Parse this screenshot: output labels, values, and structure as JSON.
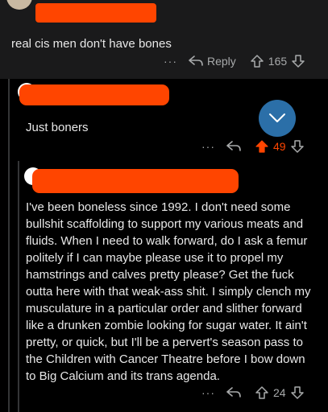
{
  "comments": [
    {
      "text": "real cis men don't have bones",
      "reply_label": "Reply",
      "score": "165",
      "more": "···"
    },
    {
      "text": "Just boners",
      "score": "49",
      "more": "···",
      "vote_color": "#ff4500"
    },
    {
      "text": "I've been boneless since 1992. I don't need some bullshit scaffolding to support my various meats and fluids. When I need to walk forward, do I ask a femur politely if I can maybe please use it to propel my hamstrings and calves pretty please? Get the fuck outta here with that weak-ass shit. I simply clench my musculature in a particular order and slither forward like a drunken zombie looking for sugar water. It ain't pretty, or quick, but I'll be a pervert's season pass to the Children with Cancer Theatre before I bow down to Big Calcium and its trans agenda.",
      "score": "24",
      "more": "···"
    }
  ],
  "colors": {
    "redaction": "#ff4500",
    "upvoted": "#ff4500",
    "collapse_button": "#2b6fa8"
  },
  "icons": [
    "reply-arrow-icon",
    "upvote-icon",
    "downvote-icon",
    "more-icon",
    "chevron-down-icon"
  ]
}
